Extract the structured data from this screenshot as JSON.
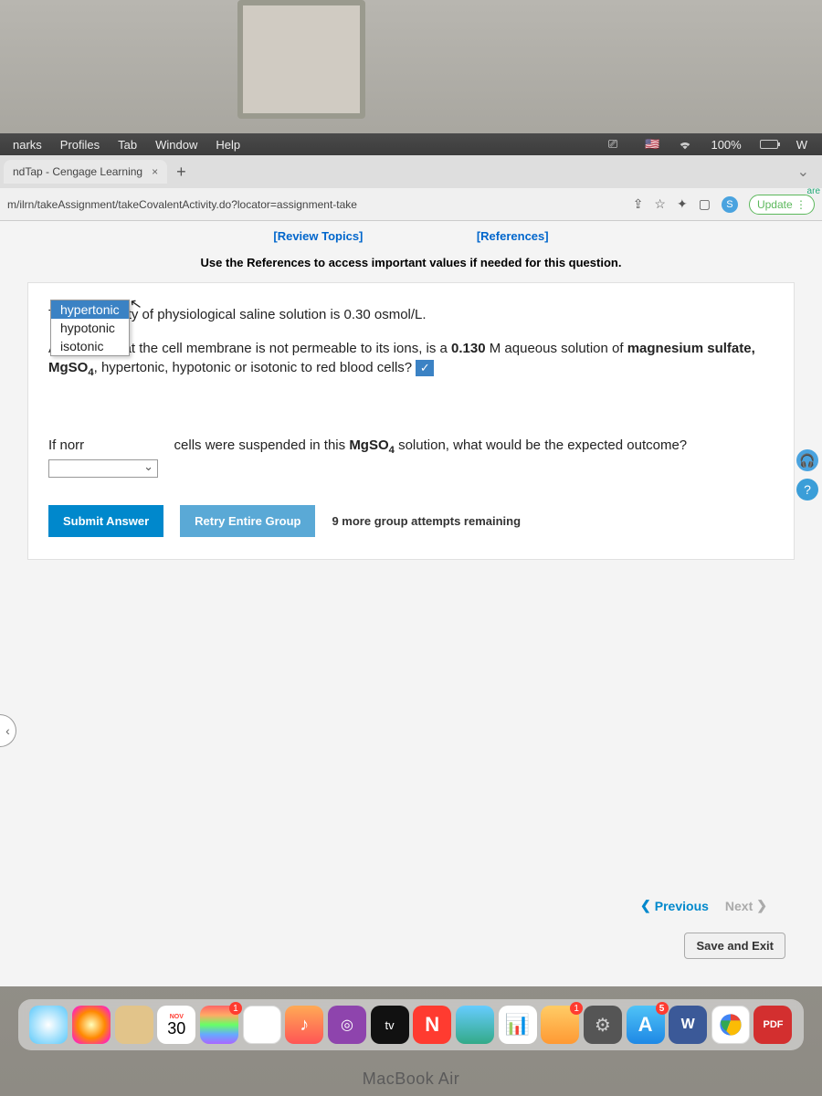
{
  "menubar": {
    "items": [
      "narks",
      "Profiles",
      "Tab",
      "Window",
      "Help"
    ],
    "battery": "100%",
    "right_letter": "W"
  },
  "tabs": {
    "active": "ndTap - Cengage Learning"
  },
  "addr": {
    "url": "m/ilrn/takeAssignment/takeCovalentActivity.do?locator=assignment-take",
    "update": "Update",
    "s": "S",
    "are": "are"
  },
  "links": {
    "review": "[Review Topics]",
    "references": "[References]"
  },
  "instruct": "Use the References to access important values if needed for this question.",
  "q": {
    "p1": "The osmolarity of physiological saline solution is 0.30 osmol/L.",
    "p2a": "Assuming that the cell membrane is not permeable to its ions, is a ",
    "p2b": "0.130",
    "p2c": " M aqueous solution of ",
    "p2d": "magnesium sulfate, MgSO",
    "p2e": ", hypertonic, hypotonic or isotonic to red blood cells? ",
    "p3a": "If norr",
    "p3b": "cells were suspended in this ",
    "p3c": "MgSO",
    "p3d": " solution, what would be the expected outcome? ",
    "opts": [
      "hypertonic",
      "hypotonic",
      "isotonic"
    ]
  },
  "buttons": {
    "submit": "Submit Answer",
    "retry": "Retry Entire Group"
  },
  "attempts": "9 more group attempts remaining",
  "nav": {
    "prev": "Previous",
    "next": "Next"
  },
  "save_exit": "Save and Exit",
  "dock": {
    "cal_month": "NOV",
    "cal_day": "30",
    "tv": "tv",
    "w": "W",
    "pdf": "PDF"
  },
  "macbook": "MacBook Air"
}
